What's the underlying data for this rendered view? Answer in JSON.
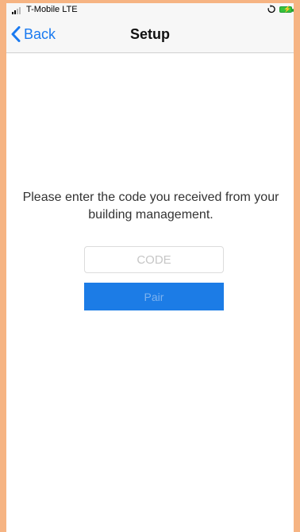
{
  "status_bar": {
    "carrier": "T-Mobile LTE",
    "sync_icon": "sync-icon",
    "battery_icon": "battery-charging-icon",
    "battery_color": "#37c23d"
  },
  "nav": {
    "back_label": "Back",
    "back_icon": "chevron-left-icon",
    "title": "Setup",
    "accent_color": "#1a7af0"
  },
  "content": {
    "instruction": "Please enter the code you received from your building management.",
    "code_input": {
      "value": "",
      "placeholder": "CODE"
    },
    "pair_button_label": "Pair",
    "pair_button_color": "#1c7ce6"
  }
}
